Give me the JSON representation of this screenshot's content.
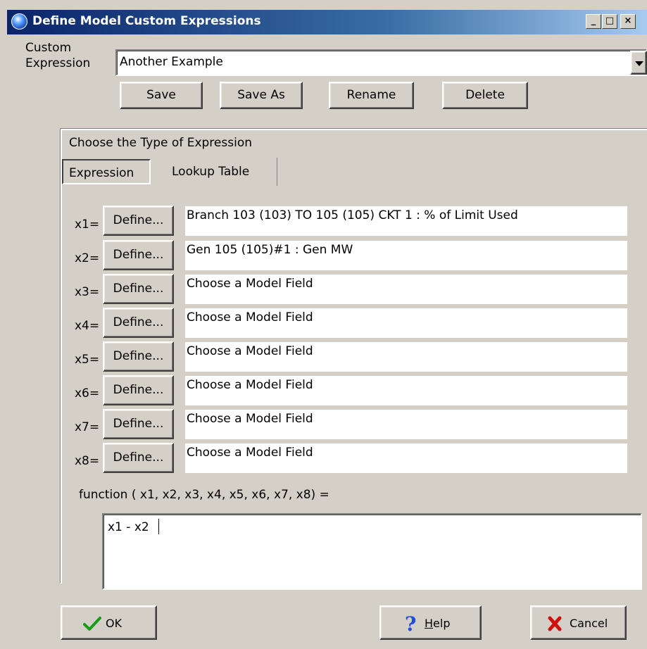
{
  "window": {
    "title": "Define Model Custom Expressions"
  },
  "titlebar_buttons": {
    "minimize": "_",
    "maximize": "□",
    "close": "×"
  },
  "custom_expression": {
    "label_line1": "Custom",
    "label_line2": "Expression",
    "value": "Another Example"
  },
  "actions": {
    "save": "Save",
    "save_as": "Save As",
    "rename": "Rename",
    "delete": "Delete"
  },
  "type_group": {
    "heading": "Choose the Type of Expression"
  },
  "tabs": [
    {
      "label": "Expression"
    },
    {
      "label": "Lookup Table"
    }
  ],
  "variables": [
    {
      "name": "x1=",
      "button": "Define...",
      "value": "Branch 103     (103)  TO  105     (105) CKT 1 : % of Limit Used"
    },
    {
      "name": "x2=",
      "button": "Define...",
      "value": "Gen 105     (105)#1 : Gen MW"
    },
    {
      "name": "x3=",
      "button": "Define...",
      "value": "Choose a Model Field"
    },
    {
      "name": "x4=",
      "button": "Define...",
      "value": "Choose a Model Field"
    },
    {
      "name": "x5=",
      "button": "Define...",
      "value": "Choose a Model Field"
    },
    {
      "name": "x6=",
      "button": "Define...",
      "value": "Choose a Model Field"
    },
    {
      "name": "x7=",
      "button": "Define...",
      "value": "Choose a Model Field"
    },
    {
      "name": "x8=",
      "button": "Define...",
      "value": "Choose a Model Field"
    }
  ],
  "function": {
    "label": "function ( x1, x2, x3, x4, x5, x6, x7, x8) =",
    "value": "x1 - x2"
  },
  "footer": {
    "ok": "OK",
    "help_prefix": "",
    "help_accel": "H",
    "help_rest": "elp",
    "cancel": "Cancel"
  },
  "colors": {
    "title_start": "#0a246a",
    "title_end": "#a6caf0",
    "face": "#d4d0c8",
    "ok_icon": "#1a9a1a",
    "help_icon": "#1f4fd8",
    "cancel_icon": "#d01010"
  },
  "icons": {
    "ok": "check-icon",
    "help": "question-icon",
    "cancel": "x-icon",
    "title": "globe-icon",
    "dropdown": "dropdown-arrow-icon"
  }
}
